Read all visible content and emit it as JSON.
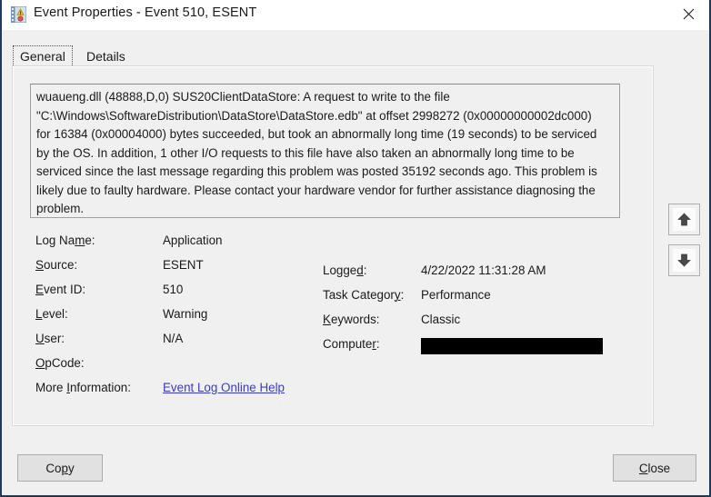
{
  "window": {
    "title": "Event Properties - Event 510, ESENT",
    "icon": "event-log-warning-icon",
    "close_label": "✕",
    "border_color": "#1f3a5f"
  },
  "tabs": [
    {
      "label": "General",
      "selected": true
    },
    {
      "label": "Details",
      "selected": false
    }
  ],
  "description": {
    "text": "wuaueng.dll (48888,D,0) SUS20ClientDataStore: A request to write to the file \"C:\\Windows\\SoftwareDistribution\\DataStore\\DataStore.edb\" at offset 2998272 (0x00000000002dc000) for 16384 (0x00004000) bytes succeeded, but took an abnormally long time (19 seconds) to be serviced by the OS. In addition, 1 other I/O requests to this file have also taken an abnormally long time to be serviced since the last message regarding this problem was posted 35192 seconds ago. This problem is likely due to faulty hardware. Please contact your hardware vendor for further assistance diagnosing the problem."
  },
  "fields_left": [
    {
      "label": "Log Name:",
      "mnemonic_index": 6,
      "value": "Application"
    },
    {
      "label": "Source:",
      "mnemonic_index": 0,
      "value": "ESENT"
    },
    {
      "label": "Event ID:",
      "mnemonic_index": 0,
      "value": "510"
    },
    {
      "label": "Level:",
      "mnemonic_index": 0,
      "value": "Warning"
    },
    {
      "label": "User:",
      "mnemonic_index": 0,
      "value": "N/A"
    },
    {
      "label": "OpCode:",
      "mnemonic_index": 0,
      "value": ""
    },
    {
      "label": "More Information:",
      "mnemonic_index": 5,
      "value": "Event Log Online Help",
      "is_link": true
    }
  ],
  "fields_right": [
    {
      "label": "Logged:",
      "mnemonic_index": 5,
      "value": "4/22/2022 11:31:28 AM"
    },
    {
      "label": "Task Category:",
      "mnemonic_index": 12,
      "value": "Performance"
    },
    {
      "label": "Keywords:",
      "mnemonic_index": 0,
      "value": "Classic"
    },
    {
      "label": "Computer:",
      "mnemonic_index": 7,
      "value": "",
      "redacted": true
    }
  ],
  "nav_buttons": [
    {
      "name": "previous-event-button",
      "icon": "arrow-up-icon"
    },
    {
      "name": "next-event-button",
      "icon": "arrow-down-icon"
    }
  ],
  "buttons": {
    "copy_label": "Copy",
    "copy_mnemonic_index": 2,
    "close_label": "Close",
    "close_mnemonic_index": 0
  },
  "colors": {
    "link": "#3b3bc8",
    "redaction": "#000000",
    "dialog_background": "#f0f0f0",
    "title_background": "#ffffff"
  }
}
